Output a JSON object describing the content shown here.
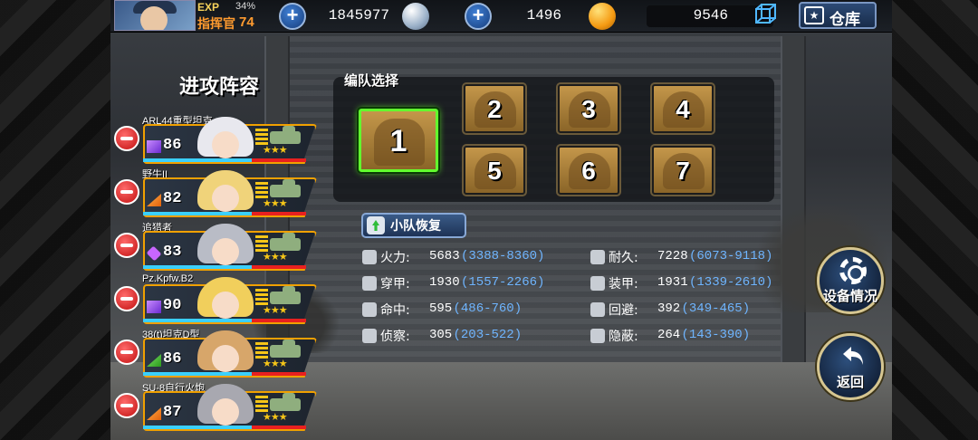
{
  "topbar": {
    "exp_label": "EXP",
    "exp_percent": "34%",
    "rank_label": "指挥官",
    "rank_level": "74",
    "silver": "1845977",
    "gold": "1496",
    "cube": "9546",
    "warehouse_label": "仓库",
    "icons": {
      "add": "plus-icon",
      "silver": "silver-coin-icon",
      "gold": "gold-coin-icon",
      "cube": "cube-icon",
      "warehouse": "warehouse-icon"
    }
  },
  "lineup": {
    "title": "进攻阵容",
    "units": [
      {
        "name": "ARL44重型坦克",
        "level": "86",
        "level_icon": "purple",
        "stars": "★★★",
        "hair": "#e8e8ee"
      },
      {
        "name": "野牛II",
        "level": "82",
        "level_icon": "orange",
        "stars": "★★★",
        "hair": "#f0d37a"
      },
      {
        "name": "追猎者",
        "level": "83",
        "level_icon": "violet",
        "stars": "★★★",
        "hair": "#b9bcc6"
      },
      {
        "name": "Pz.Kpfw.B2",
        "level": "90",
        "level_icon": "purple",
        "stars": "★★★",
        "hair": "#f1cf5c"
      },
      {
        "name": "38(t)坦克D型",
        "level": "86",
        "level_icon": "green",
        "stars": "★★★",
        "hair": "#d7a66a"
      },
      {
        "name": "SU-8自行火炮",
        "level": "87",
        "level_icon": "orange",
        "stars": "★★★",
        "hair": "#a8a8b0"
      }
    ]
  },
  "formation": {
    "title": "编队选择",
    "slots": [
      "1",
      "2",
      "3",
      "4",
      "5",
      "6",
      "7"
    ],
    "active": "1"
  },
  "restore": {
    "label": "小队恢复"
  },
  "stats": [
    {
      "label": "火力:",
      "value": "5683",
      "range": "(3388-8360)",
      "icon": "firepower-icon"
    },
    {
      "label": "耐久:",
      "value": "7228",
      "range": "(6073-9118)",
      "icon": "durability-icon"
    },
    {
      "label": "穿甲:",
      "value": "1930",
      "range": "(1557-2266)",
      "icon": "penetration-icon"
    },
    {
      "label": "装甲:",
      "value": "1931",
      "range": "(1339-2610)",
      "icon": "armor-icon"
    },
    {
      "label": "命中:",
      "value": "595",
      "range": "(486-760)",
      "icon": "accuracy-icon"
    },
    {
      "label": "回避:",
      "value": "392",
      "range": "(349-465)",
      "icon": "evasion-icon"
    },
    {
      "label": "侦察:",
      "value": "305",
      "range": "(203-522)",
      "icon": "recon-icon"
    },
    {
      "label": "隐蔽:",
      "value": "264",
      "range": "(143-390)",
      "icon": "stealth-icon"
    }
  ],
  "buttons": {
    "equipment_label": "设备情况",
    "back_label": "返回"
  },
  "colors": {
    "active_slot": "#62ff2e",
    "range_text": "#6fb5ff",
    "unit_frame": "#f0a000"
  }
}
